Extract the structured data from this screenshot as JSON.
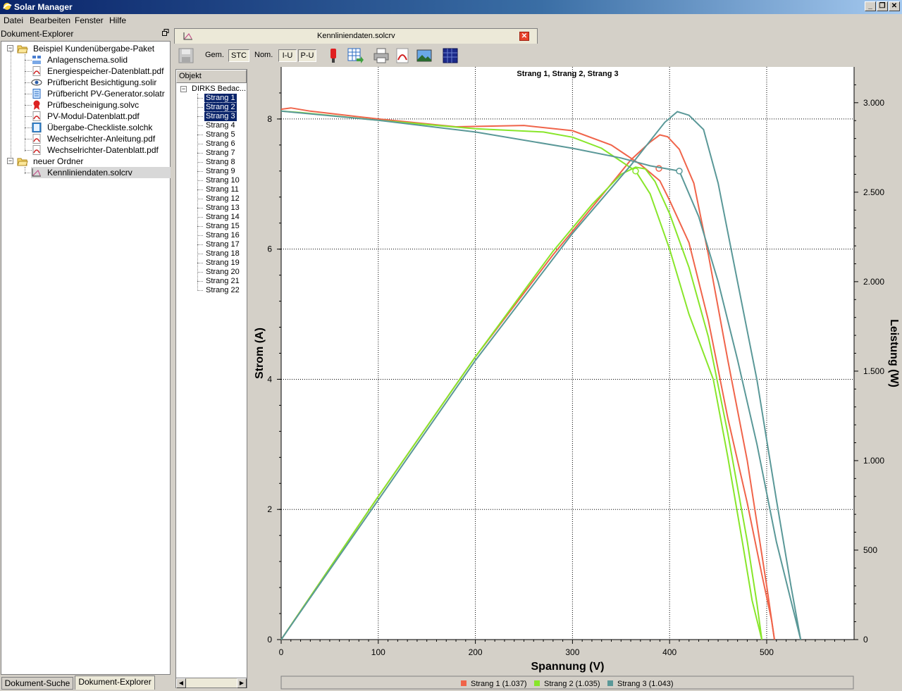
{
  "window": {
    "title": "Solar Manager"
  },
  "menu": [
    "Datei",
    "Bearbeiten",
    "Fenster",
    "Hilfe"
  ],
  "explorer": {
    "title": "Dokument-Explorer",
    "items": [
      {
        "label": "Beispiel Kundenübergabe-Paket",
        "icon": "folder-open-icon"
      },
      {
        "label": "Anlagenschema.solid",
        "icon": "schema-icon"
      },
      {
        "label": "Energiespeicher-Datenblatt.pdf",
        "icon": "pdf-icon"
      },
      {
        "label": "Prüfbericht Besichtigung.solir",
        "icon": "eye-icon"
      },
      {
        "label": "Prüfbericht PV-Generator.solatr",
        "icon": "report-icon"
      },
      {
        "label": "Prüfbescheinigung.solvc",
        "icon": "certificate-icon"
      },
      {
        "label": "PV-Modul-Datenblatt.pdf",
        "icon": "pdf-icon"
      },
      {
        "label": "Übergabe-Checkliste.solchk",
        "icon": "checklist-icon"
      },
      {
        "label": "Wechselrichter-Anleitung.pdf",
        "icon": "pdf-icon"
      },
      {
        "label": "Wechselrichter-Datenblatt.pdf",
        "icon": "pdf-icon"
      },
      {
        "label": "neuer Ordner",
        "icon": "folder-open-icon"
      },
      {
        "label": "Kennliniendaten.solcrv",
        "icon": "curve-icon"
      }
    ],
    "tabs": [
      "Dokument-Suche",
      "Dokument-Explorer"
    ]
  },
  "document": {
    "tab_title": "Kennliniendaten.solcrv",
    "toolbar": {
      "gem": "Gem.",
      "stc": "STC",
      "nom": "Nom.",
      "iu": "I-U",
      "pu": "P-U"
    },
    "object_panel": {
      "header": "Objekt",
      "root": "DIRKS Bedac...",
      "items": [
        "Strang 1",
        "Strang 2",
        "Strang 3",
        "Strang 4",
        "Strang 5",
        "Strang 6",
        "Strang 7",
        "Strang 8",
        "Strang 9",
        "Strang 10",
        "Strang 11",
        "Strang 12",
        "Strang 13",
        "Strang 14",
        "Strang 15",
        "Strang 16",
        "Strang 17",
        "Strang 18",
        "Strang 19",
        "Strang 20",
        "Strang 21",
        "Strang 22"
      ],
      "selected": [
        0,
        1,
        2
      ]
    }
  },
  "chart_data": {
    "type": "line",
    "title": "Strang 1, Strang 2, Strang 3",
    "xlabel": "Spannung (V)",
    "ylabel": "Strom (A)",
    "y2label": "Leistung (W)",
    "xlim": [
      0,
      590
    ],
    "ylim": [
      0,
      8.8
    ],
    "y2lim": [
      0,
      3200
    ],
    "xticks": [
      0,
      100,
      200,
      300,
      400,
      500
    ],
    "yticks": [
      0,
      2,
      4,
      6,
      8
    ],
    "y2ticks": [
      0,
      500,
      1000,
      1500,
      2000,
      2500,
      3000
    ],
    "y2ticklabels": [
      "0",
      "500",
      "1.000",
      "1.500",
      "2.000",
      "2.500",
      "3.000"
    ],
    "grid": true,
    "legend_position": "bottom",
    "series": [
      {
        "name": "Strang 1 (1.037)",
        "color": "#f0644a",
        "iu": [
          [
            0,
            8.15
          ],
          [
            10,
            8.17
          ],
          [
            30,
            8.12
          ],
          [
            100,
            8.0
          ],
          [
            180,
            7.88
          ],
          [
            250,
            7.9
          ],
          [
            300,
            7.82
          ],
          [
            340,
            7.6
          ],
          [
            370,
            7.3
          ],
          [
            390,
            7.05
          ],
          [
            400,
            6.75
          ],
          [
            420,
            6.1
          ],
          [
            440,
            4.9
          ],
          [
            460,
            3.4
          ],
          [
            480,
            2.1
          ],
          [
            495,
            1.0
          ],
          [
            505,
            0.3
          ],
          [
            508,
            0
          ]
        ],
        "pu": [
          [
            0,
            0
          ],
          [
            100,
            800
          ],
          [
            200,
            1580
          ],
          [
            280,
            2150
          ],
          [
            330,
            2480
          ],
          [
            360,
            2680
          ],
          [
            380,
            2780
          ],
          [
            390,
            2820
          ],
          [
            398,
            2810
          ],
          [
            410,
            2740
          ],
          [
            425,
            2550
          ],
          [
            440,
            2150
          ],
          [
            460,
            1560
          ],
          [
            480,
            1000
          ],
          [
            500,
            300
          ],
          [
            508,
            0
          ]
        ],
        "mpp": [
          389,
          7.24
        ]
      },
      {
        "name": "Strang 2 (1.035)",
        "color": "#88e62a",
        "iu": [
          [
            0,
            8.12
          ],
          [
            20,
            8.1
          ],
          [
            100,
            7.98
          ],
          [
            200,
            7.85
          ],
          [
            270,
            7.8
          ],
          [
            300,
            7.72
          ],
          [
            330,
            7.55
          ],
          [
            350,
            7.35
          ],
          [
            365,
            7.2
          ],
          [
            380,
            6.85
          ],
          [
            400,
            6.0
          ],
          [
            420,
            5.0
          ],
          [
            445,
            4.0
          ],
          [
            460,
            2.8
          ],
          [
            475,
            1.5
          ],
          [
            485,
            0.6
          ],
          [
            495,
            0
          ]
        ],
        "pu": [
          [
            0,
            0
          ],
          [
            100,
            800
          ],
          [
            200,
            1580
          ],
          [
            280,
            2170
          ],
          [
            320,
            2430
          ],
          [
            350,
            2600
          ],
          [
            365,
            2640
          ],
          [
            375,
            2630
          ],
          [
            385,
            2560
          ],
          [
            400,
            2380
          ],
          [
            420,
            2080
          ],
          [
            440,
            1690
          ],
          [
            460,
            1150
          ],
          [
            480,
            550
          ],
          [
            490,
            200
          ],
          [
            495,
            0
          ]
        ],
        "mpp": [
          365,
          7.2
        ]
      },
      {
        "name": "Strang 3 (1.043)",
        "color": "#5a9898",
        "iu": [
          [
            0,
            8.12
          ],
          [
            100,
            7.98
          ],
          [
            200,
            7.8
          ],
          [
            300,
            7.55
          ],
          [
            350,
            7.4
          ],
          [
            380,
            7.28
          ],
          [
            410,
            7.2
          ],
          [
            430,
            6.5
          ],
          [
            450,
            5.5
          ],
          [
            470,
            4.3
          ],
          [
            490,
            3.0
          ],
          [
            510,
            1.5
          ],
          [
            525,
            0.6
          ],
          [
            535,
            0
          ]
        ],
        "pu": [
          [
            0,
            0
          ],
          [
            100,
            780
          ],
          [
            200,
            1560
          ],
          [
            300,
            2270
          ],
          [
            360,
            2650
          ],
          [
            395,
            2890
          ],
          [
            408,
            2950
          ],
          [
            420,
            2930
          ],
          [
            435,
            2850
          ],
          [
            450,
            2550
          ],
          [
            470,
            2000
          ],
          [
            490,
            1450
          ],
          [
            510,
            780
          ],
          [
            525,
            300
          ],
          [
            535,
            0
          ]
        ],
        "mpp": [
          410,
          7.2
        ]
      }
    ]
  }
}
